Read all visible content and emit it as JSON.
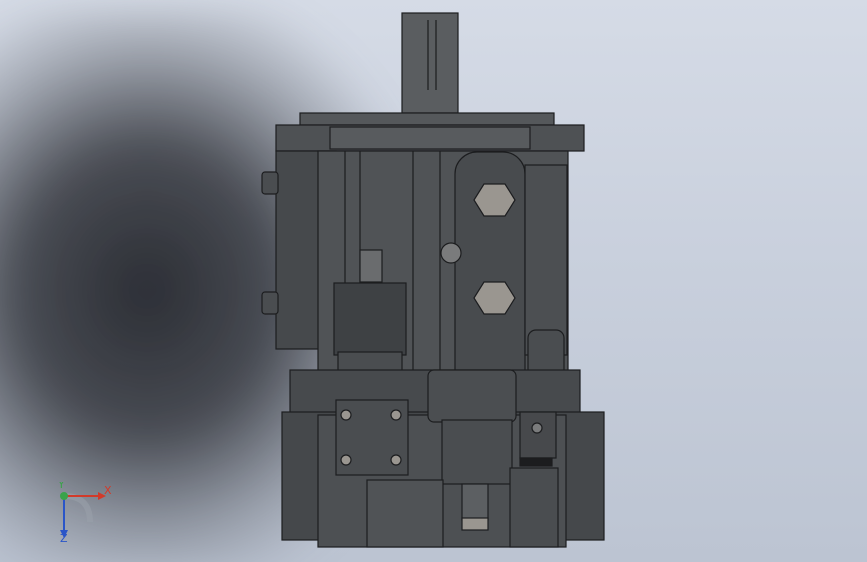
{
  "viewport": {
    "background_top": "#d5dbe6",
    "background_bottom": "#bcc4d2"
  },
  "model": {
    "body_color": "#4a4d50",
    "edge_color": "#1c1d1f",
    "nut_color": "#9a9690"
  },
  "triad": {
    "x_label": "X",
    "y_label": "Y",
    "z_label": "Z",
    "x_color": "#d23a2a",
    "y_color": "#3aa34a",
    "z_color": "#2a55c8"
  }
}
